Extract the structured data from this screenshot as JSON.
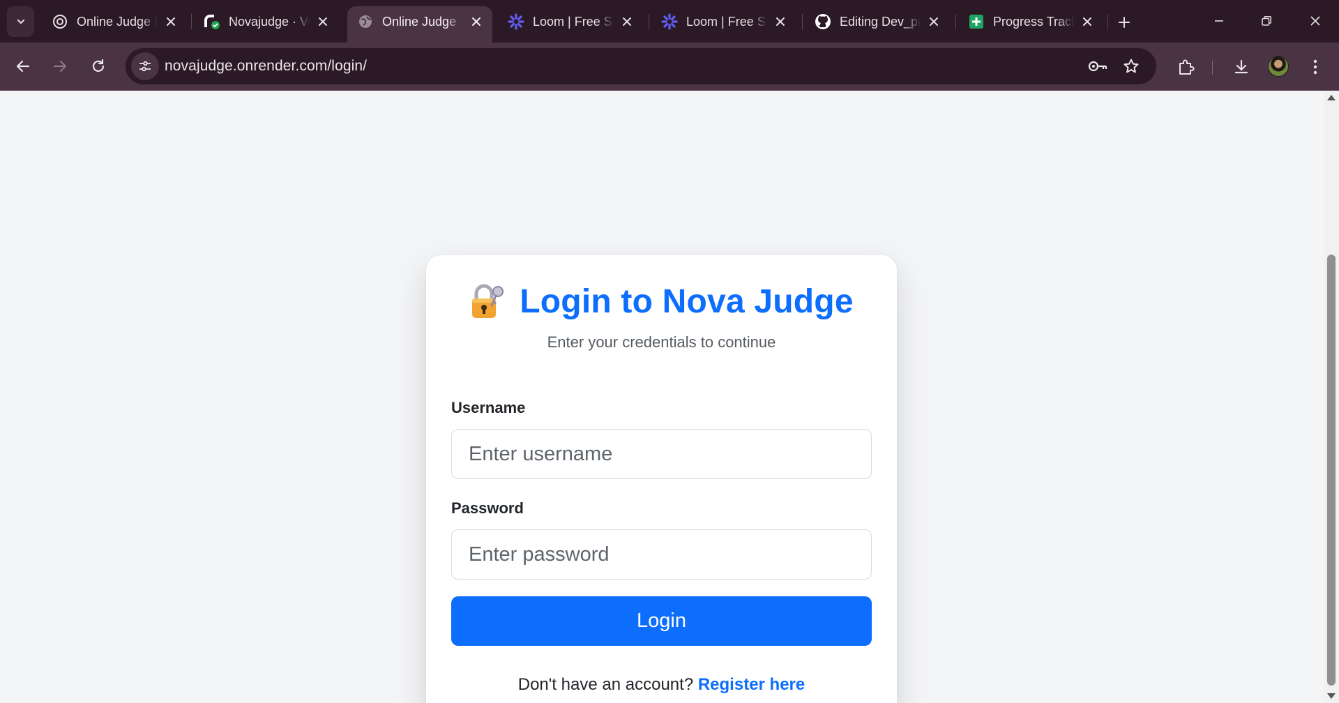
{
  "browser": {
    "tabs": [
      {
        "title": "Online Judge Platform",
        "icon": "openai-icon",
        "active": false
      },
      {
        "title": "Novajudge · Verified",
        "icon": "render-icon",
        "active": false
      },
      {
        "title": "Online Judge",
        "icon": "globe-icon",
        "active": true
      },
      {
        "title": "Loom | Free Screen Recorder",
        "icon": "loom-icon",
        "active": false
      },
      {
        "title": "Loom | Free Screen Recorder",
        "icon": "loom-icon",
        "active": false
      },
      {
        "title": "Editing Dev_profile",
        "icon": "github-icon",
        "active": false
      },
      {
        "title": "Progress Tracker",
        "icon": "sheets-icon",
        "active": false
      }
    ],
    "url": "novajudge.onrender.com/login/"
  },
  "login": {
    "heading": "Login to Nova Judge",
    "subtitle": "Enter your credentials to continue",
    "username_label": "Username",
    "username_placeholder": "Enter username",
    "password_label": "Password",
    "password_placeholder": "Enter password",
    "submit_label": "Login",
    "register_prompt": "Don't have an account?",
    "register_link": "Register here"
  },
  "colors": {
    "accent": "#0d6efd",
    "tabbar": "#2b1a26",
    "toolbar": "#4a3342",
    "page_bg": "#f4f5f7"
  }
}
